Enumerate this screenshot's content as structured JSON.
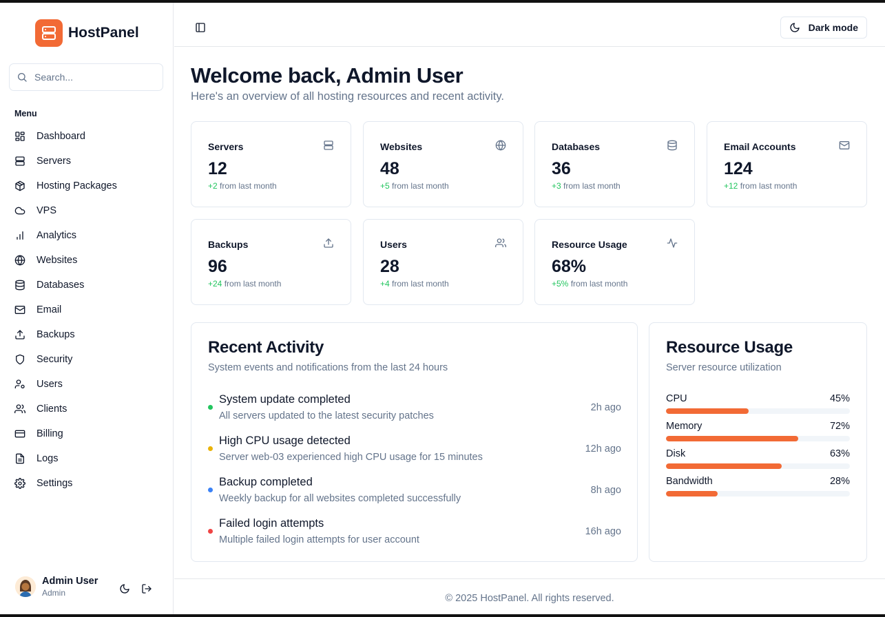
{
  "brand": {
    "name": "HostPanel",
    "logo_icon": "server-stack-icon",
    "accent": "#f26a35"
  },
  "search": {
    "placeholder": "Search..."
  },
  "sidebar": {
    "menu_title": "Menu",
    "items": [
      {
        "label": "Dashboard",
        "icon": "dashboard-icon"
      },
      {
        "label": "Servers",
        "icon": "server-icon"
      },
      {
        "label": "Hosting Packages",
        "icon": "package-icon"
      },
      {
        "label": "VPS",
        "icon": "cloud-icon"
      },
      {
        "label": "Analytics",
        "icon": "bar-chart-icon"
      },
      {
        "label": "Websites",
        "icon": "globe-icon"
      },
      {
        "label": "Databases",
        "icon": "database-icon"
      },
      {
        "label": "Email",
        "icon": "mail-icon"
      },
      {
        "label": "Backups",
        "icon": "upload-icon"
      },
      {
        "label": "Security",
        "icon": "shield-icon"
      },
      {
        "label": "Users",
        "icon": "user-cog-icon"
      },
      {
        "label": "Clients",
        "icon": "users-icon"
      },
      {
        "label": "Billing",
        "icon": "credit-card-icon"
      },
      {
        "label": "Logs",
        "icon": "file-text-icon"
      },
      {
        "label": "Settings",
        "icon": "gear-icon"
      }
    ]
  },
  "profile": {
    "name": "Admin User",
    "role": "Admin"
  },
  "topbar": {
    "dark_mode_label": "Dark mode"
  },
  "header": {
    "title": "Welcome back, Admin User",
    "subtitle": "Here's an overview of all hosting resources and recent activity."
  },
  "stats": [
    {
      "title": "Servers",
      "value": "12",
      "change": "+2",
      "suffix": " from last month",
      "icon": "server-icon"
    },
    {
      "title": "Websites",
      "value": "48",
      "change": "+5",
      "suffix": " from last month",
      "icon": "globe-icon"
    },
    {
      "title": "Databases",
      "value": "36",
      "change": "+3",
      "suffix": " from last month",
      "icon": "database-icon"
    },
    {
      "title": "Email Accounts",
      "value": "124",
      "change": "+12",
      "suffix": " from last month",
      "icon": "mail-icon"
    },
    {
      "title": "Backups",
      "value": "96",
      "change": "+24",
      "suffix": " from last month",
      "icon": "upload-icon"
    },
    {
      "title": "Users",
      "value": "28",
      "change": "+4",
      "suffix": " from last month",
      "icon": "users-icon"
    },
    {
      "title": "Resource Usage",
      "value": "68%",
      "change": "+5%",
      "suffix": " from last month",
      "icon": "activity-icon"
    }
  ],
  "activity": {
    "title": "Recent Activity",
    "subtitle": "System events and notifications from the last 24 hours",
    "items": [
      {
        "title": "System update completed",
        "desc": "All servers updated to the latest security patches",
        "time": "2h ago",
        "color": "#22c55e"
      },
      {
        "title": "High CPU usage detected",
        "desc": "Server web-03 experienced high CPU usage for 15 minutes",
        "time": "12h ago",
        "color": "#eab308"
      },
      {
        "title": "Backup completed",
        "desc": "Weekly backup for all websites completed successfully",
        "time": "8h ago",
        "color": "#3b82f6"
      },
      {
        "title": "Failed login attempts",
        "desc": "Multiple failed login attempts for user account",
        "time": "16h ago",
        "color": "#ef4444"
      }
    ]
  },
  "resources": {
    "title": "Resource Usage",
    "subtitle": "Server resource utilization",
    "items": [
      {
        "label": "CPU",
        "value": "45%",
        "percent": 45
      },
      {
        "label": "Memory",
        "value": "72%",
        "percent": 72
      },
      {
        "label": "Disk",
        "value": "63%",
        "percent": 63
      },
      {
        "label": "Bandwidth",
        "value": "28%",
        "percent": 28
      }
    ]
  },
  "footer": {
    "text": "© 2025 HostPanel. All rights reserved."
  }
}
